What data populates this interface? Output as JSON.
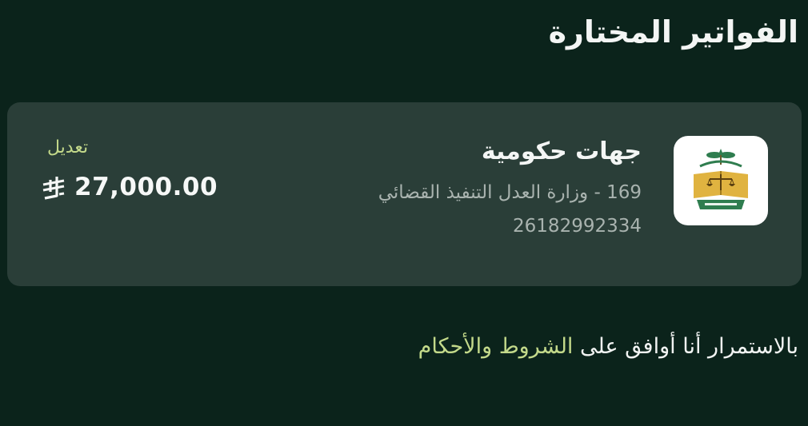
{
  "page": {
    "title": "الفواتير المختارة"
  },
  "bill": {
    "category": "جهات حكومية",
    "biller_name": "169 - وزارة العدل التنفيذ القضائي",
    "bill_number": "26182992334",
    "amount": "27,000.00",
    "currency_icon": "saudi-riyal-symbol",
    "edit_label": "تعديل",
    "logo_icon": "ministry-of-justice-emblem"
  },
  "terms": {
    "prefix": "بالاستمرار أنا أوافق على",
    "link_label": "الشروط والأحكام"
  },
  "colors": {
    "background": "#0b231b",
    "card": "#2a3e38",
    "accent": "#c3d98a",
    "muted_text": "#a9b3af"
  }
}
